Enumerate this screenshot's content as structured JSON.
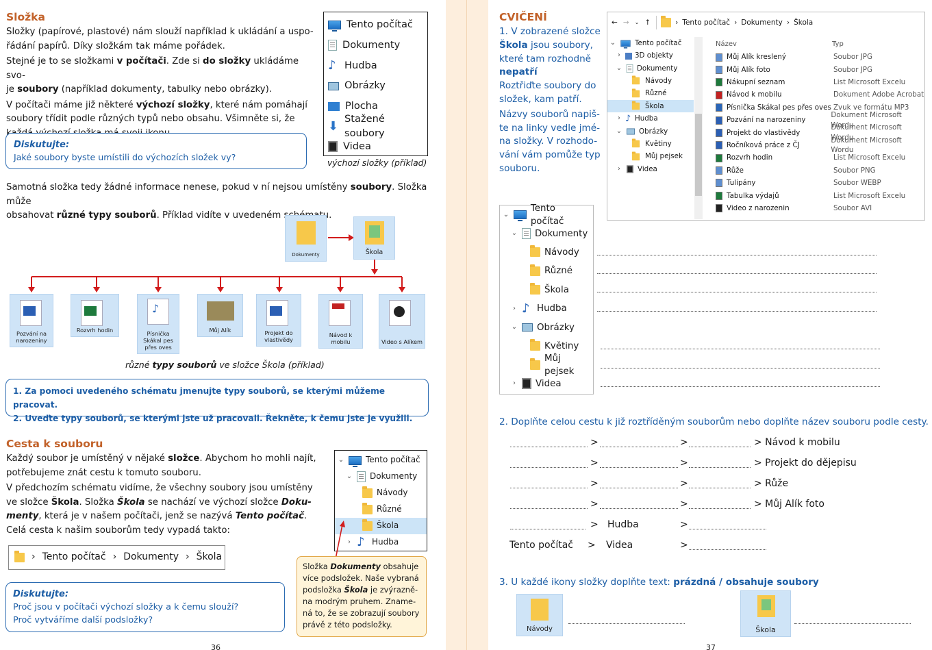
{
  "left": {
    "title1": "Složka",
    "p1a": "Složky (papírové, plastové) nám slouží například k ukládání a uspo-",
    "p1b": "řádání papírů. Díky složkám tak máme pořádek.",
    "p2a1": "Stejné je to se složkami ",
    "p2a2": "v počítači",
    "p2a3": ". Zde si ",
    "p2a4": "do složky",
    "p2a5": " ukládáme svo-",
    "p2b1": "je ",
    "p2b2": "soubory",
    "p2b3": " (například dokumenty, tabulky nebo obrázky).",
    "p3a1": "V počítači máme již některé ",
    "p3a2": "výchozí složky",
    "p3a3": ", které nám pomáhají",
    "p3b": "soubory třídit podle různých typů nebo obsahu. Všimněte si, že",
    "p3c": "každá výchozí složka má svoji ikonu.",
    "disk1_title": "Diskutujte:",
    "disk1_text": "Jaké soubory byste umístili do výchozích složek vy?",
    "folders": [
      "Tento počítač",
      "Dokumenty",
      "Hudba",
      "Obrázky",
      "Plocha",
      "Stažené soubory",
      "Videa"
    ],
    "folders_caption": "výchozí složky (příklad)",
    "p4a1": "Samotná složka tedy žádné informace nenese, pokud v ní nejsou umístěny ",
    "p4a2": "soubory",
    "p4a3": ". Složka může",
    "p4b1": "obsahovat ",
    "p4b2": "různé typy souborů",
    "p4b3": ". Příklad vidíte v uvedeném schématu.",
    "schema_top": [
      "Dokumenty",
      "Škola"
    ],
    "schema_files": [
      "Pozvání na narozeniny",
      "Rozvrh hodin",
      "Písnička Skákal pes přes oves",
      "Můj Alík",
      "Projekt do vlastivědy",
      "Návod k mobilu",
      "Video s Alíkem"
    ],
    "schema_caption1": "různé ",
    "schema_caption2": "typy souborů",
    "schema_caption3": " ve složce Škola (příklad)",
    "task1": "1. Za pomoci uvedeného schématu jmenujte typy souborů, se kterými můžeme pracovat.",
    "task2": "2. Uveďte typy souborů, se kterými jste už pracovali. Řekněte, k čemu jste je využili.",
    "title2": "Cesta k souboru",
    "c1a1": "Každý soubor je umístěný v nějaké ",
    "c1a2": "složce",
    "c1a3": ". Abychom ho mohli najít,",
    "c1b": "potřebujeme znát cestu k tomuto souboru.",
    "c2a": "V předchozím schématu vidíme, že všechny soubory jsou umístěny",
    "c2b1": "ve složce ",
    "c2b2": "Škola",
    "c2b3": ". Složka ",
    "c2b4": "Škola",
    "c2b5": " se nachází ve výchozí složce ",
    "c2b6": "Doku-",
    "c2c1": "menty",
    "c2c2": ", která je v našem počítači, jenž se nazývá ",
    "c2c3": "Tento počítač",
    "c2c4": ".",
    "c3": "Celá cesta k našim souborům tedy vypadá takto:",
    "path": [
      "Tento počítač",
      "Dokumenty",
      "Škola"
    ],
    "tree2": [
      "Tento počítač",
      "Dokumenty",
      "Návody",
      "Různé",
      "Škola",
      "Hudba"
    ],
    "note1": "Složka ",
    "note2": "Dokumenty",
    "note3": " obsahuje",
    "note4": "více podsložek. Naše vybraná",
    "note5": "podsložka ",
    "note6": "Škola",
    "note7": " je zvýrazně-",
    "note8": "na modrým pruhem. Zname-",
    "note9": "ná to, že se zobrazují soubory",
    "note10": "právě z této podsložky.",
    "disk2_title": "Diskutujte:",
    "disk2_l1": "Proč jsou v počítači výchozí složky a k čemu slouží?",
    "disk2_l2": "Proč vytváříme další podsložky?",
    "page": "36"
  },
  "right": {
    "title": "CVIČENÍ",
    "e1a1": "1. V zobrazené složce",
    "e1b1": "Škola",
    "e1b2": " jsou soubory,",
    "e1c": "které tam rozhodně",
    "e1d": "nepatří",
    ".": ".",
    "e1e": "Roztřiďte soubory do",
    "e1f": "složek, kam patří.",
    "e1g": "Názvy souborů napiš-",
    "e1h": "te na linky vedle jmé-",
    "e1i": "na složky. V rozhodo-",
    "e1j": "vání vám pomůže typ",
    "e1k": "souboru.",
    "explorer_path": [
      "Tento počítač",
      "Dokumenty",
      "Škola"
    ],
    "explorer_tree": [
      "Tento počítač",
      "3D objekty",
      "Dokumenty",
      "Návody",
      "Různé",
      "Škola",
      "Hudba",
      "Obrázky",
      "Květiny",
      "Můj pejsek",
      "Videa"
    ],
    "col_name": "Název",
    "col_type": "Typ",
    "files": [
      {
        "n": "Můj Alík kreslený",
        "t": "Soubor JPG"
      },
      {
        "n": "Můj Alík foto",
        "t": "Soubor JPG"
      },
      {
        "n": "Nákupní seznam",
        "t": "List Microsoft Excelu"
      },
      {
        "n": "Návod k mobilu",
        "t": "Dokument Adobe Acrobat"
      },
      {
        "n": "Písnička Skákal pes přes oves",
        "t": "Zvuk ve formátu MP3"
      },
      {
        "n": "Pozvání na narozeniny",
        "t": "Dokument Microsoft Wordu"
      },
      {
        "n": "Projekt do vlastivědy",
        "t": "Dokument Microsoft Wordu"
      },
      {
        "n": "Ročníková práce z ČJ",
        "t": "Dokument Microsoft Wordu"
      },
      {
        "n": "Rozvrh hodin",
        "t": "List Microsoft Excelu"
      },
      {
        "n": "Růže",
        "t": "Soubor PNG"
      },
      {
        "n": "Tulipány",
        "t": "Soubor WEBP"
      },
      {
        "n": "Tabulka výdajů",
        "t": "List Microsoft Excelu"
      },
      {
        "n": "Video z narozenin",
        "t": "Soubor AVI"
      }
    ],
    "tree3": [
      "Tento počítač",
      "Dokumenty",
      "Návody",
      "Různé",
      "Škola",
      "Hudba",
      "Obrázky",
      "Květiny",
      "Můj pejsek",
      "Videa"
    ],
    "ex2": "2. Doplňte celou cestu k již roztříděným souborům nebo doplňte název souboru podle cesty.",
    "paths": [
      "> Návod k mobilu",
      "> Projekt do dějepisu",
      "> Růže",
      "> Můj Alík foto"
    ],
    "hudba": "Hudba",
    "videa": "Videa",
    "tento": "Tento počítač",
    "gt": ">",
    "ex3a": "3. U každé ikony složky doplňte text: ",
    "ex3b": "prázdná / obsahuje soubory",
    "ex3_icons": [
      "Návody",
      "Škola"
    ],
    "page": "37"
  },
  "colors": {
    "orange": "#c2622a",
    "blue": "#1d5ea6",
    "gutter": "#fdeedd"
  }
}
